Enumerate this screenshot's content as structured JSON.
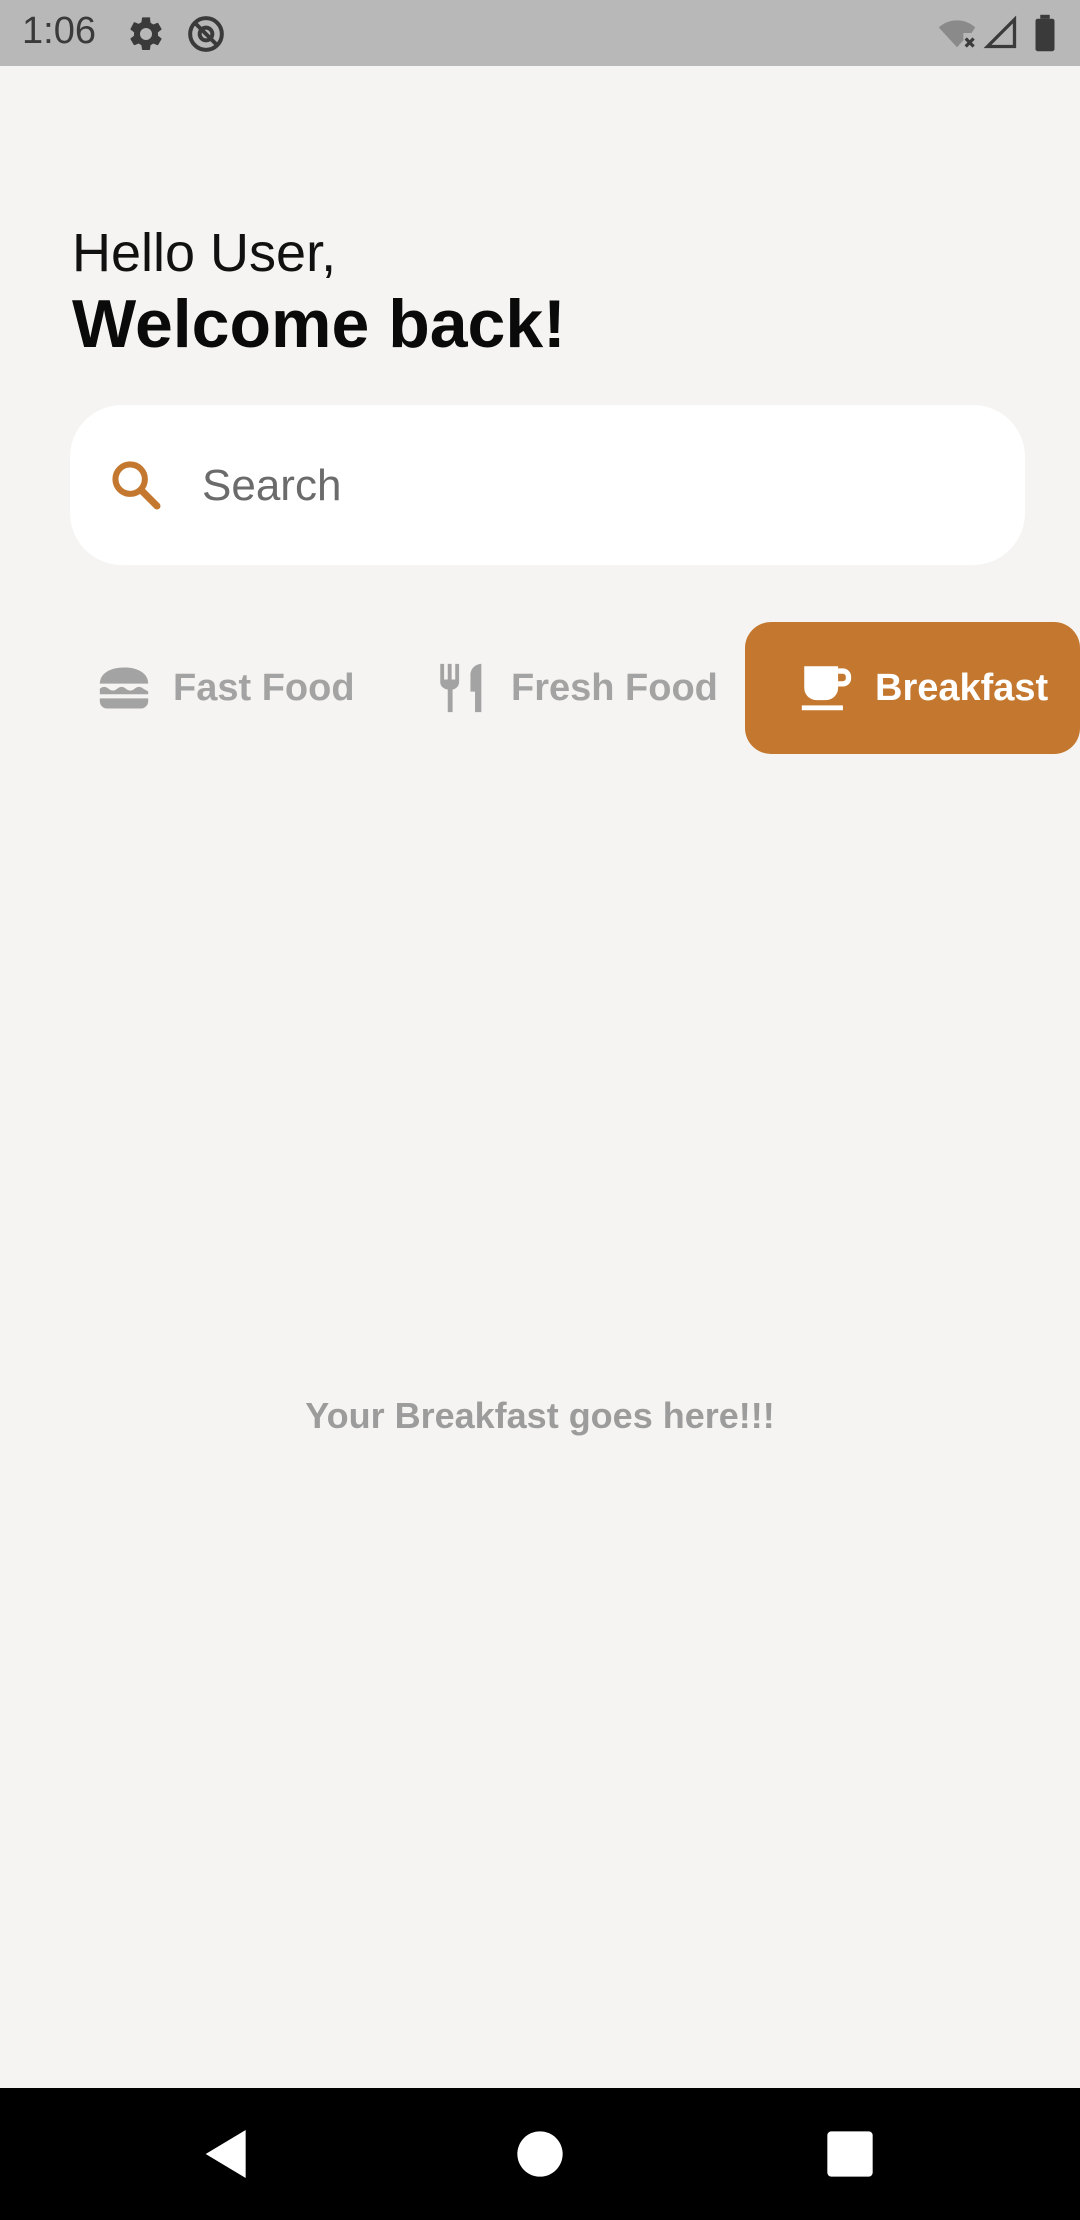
{
  "status_bar": {
    "time": "1:06",
    "left_icons": [
      "gear-icon",
      "at-sign-icon"
    ],
    "right_icons": [
      "wifi-off-icon",
      "cell-signal-icon",
      "battery-icon"
    ]
  },
  "header": {
    "greeting": "Hello User,",
    "welcome": "Welcome back!"
  },
  "search": {
    "placeholder": "Search",
    "value": "",
    "icon": "search-icon"
  },
  "categories": [
    {
      "label": "Fast Food",
      "icon": "burger-icon",
      "selected": false
    },
    {
      "label": "Fresh Food",
      "icon": "fork-knife-icon",
      "selected": false
    },
    {
      "label": "Breakfast",
      "icon": "coffee-cup-icon",
      "selected": true
    }
  ],
  "content": {
    "empty_message": "Your Breakfast goes here!!!"
  },
  "nav_bar": {
    "buttons": [
      "back-icon",
      "home-icon",
      "recents-icon"
    ]
  },
  "colors": {
    "accent": "#c4782f",
    "background": "#f5f4f2",
    "inactive_text": "#a3a3a3",
    "status_bar": "#b8b8b8"
  }
}
